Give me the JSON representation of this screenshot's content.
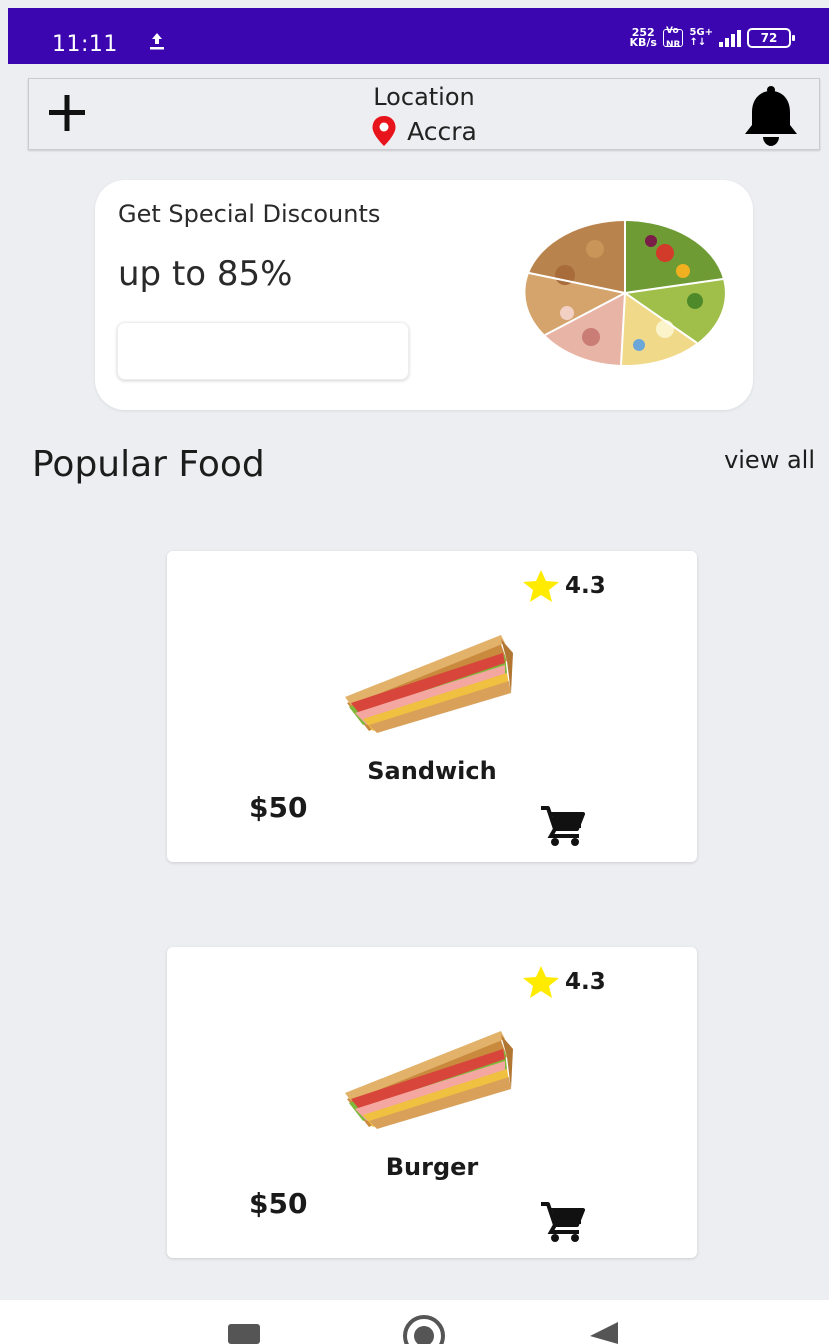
{
  "status_bar": {
    "time": "11:11",
    "speed_value": "252",
    "speed_unit": "KB/s",
    "volte_top": "Vo",
    "volte_bottom": "NR",
    "network": "5G+",
    "network_sub": "↑↓",
    "battery": "72"
  },
  "header": {
    "location_label": "Location",
    "location_value": "Accra",
    "icons": {
      "left": "plus-icon",
      "pin": "location-pin-icon",
      "right": "bell-icon"
    },
    "pin_color": "#e8141b"
  },
  "promo": {
    "subtitle": "Get Special Discounts",
    "headline": "up to 85%"
  },
  "popular": {
    "title": "Popular Food",
    "view_all": "view all",
    "items": [
      {
        "rating": "4.3",
        "name": "Sandwich",
        "price": "$50"
      },
      {
        "rating": "4.3",
        "name": "Burger",
        "price": "$50"
      }
    ]
  },
  "colors": {
    "status_bar": "#3b05b0",
    "background": "#eceef1",
    "star": "#ffeb00"
  }
}
